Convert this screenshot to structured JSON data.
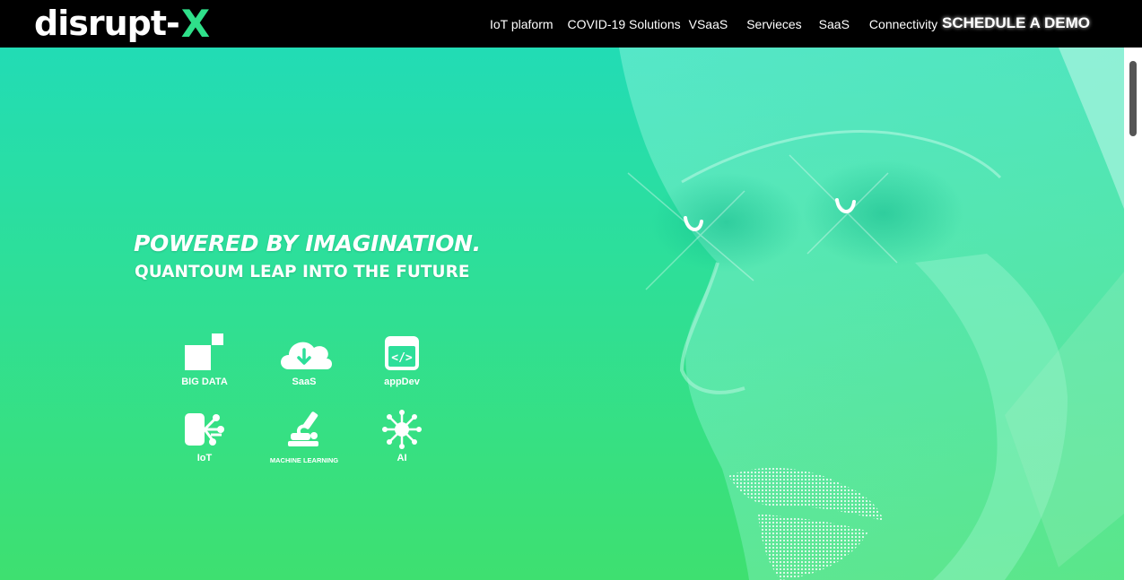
{
  "brand": {
    "logo_text": "disrupt-",
    "logo_accent": "X"
  },
  "nav": {
    "items": [
      {
        "label": "IoT plaform"
      },
      {
        "label": "COVID-19 Solutions"
      },
      {
        "label": "VSaaS"
      },
      {
        "label": "Servieces"
      },
      {
        "label": "SaaS"
      },
      {
        "label": "Connectivity"
      }
    ],
    "cta_label": "SCHEDULE A DEMO"
  },
  "hero": {
    "headline": "POWERED BY IMAGINATION.",
    "subheadline": "QUANTOUM LEAP INTO THE FUTURE",
    "tiles": [
      {
        "label": "BIG DATA",
        "icon": "big-data-icon"
      },
      {
        "label": "SaaS",
        "icon": "cloud-download-icon"
      },
      {
        "label": "appDev",
        "icon": "code-window-icon"
      },
      {
        "label": "IoT",
        "icon": "iot-node-icon"
      },
      {
        "label": "MACHINE LEARNING",
        "icon": "microscope-icon"
      },
      {
        "label": "AI",
        "icon": "ai-virus-icon"
      }
    ]
  },
  "colors": {
    "brand_accent": "#2fe08a",
    "hero_top": "#22dcb5",
    "hero_bottom": "#3ee070",
    "topbar": "#000000"
  }
}
